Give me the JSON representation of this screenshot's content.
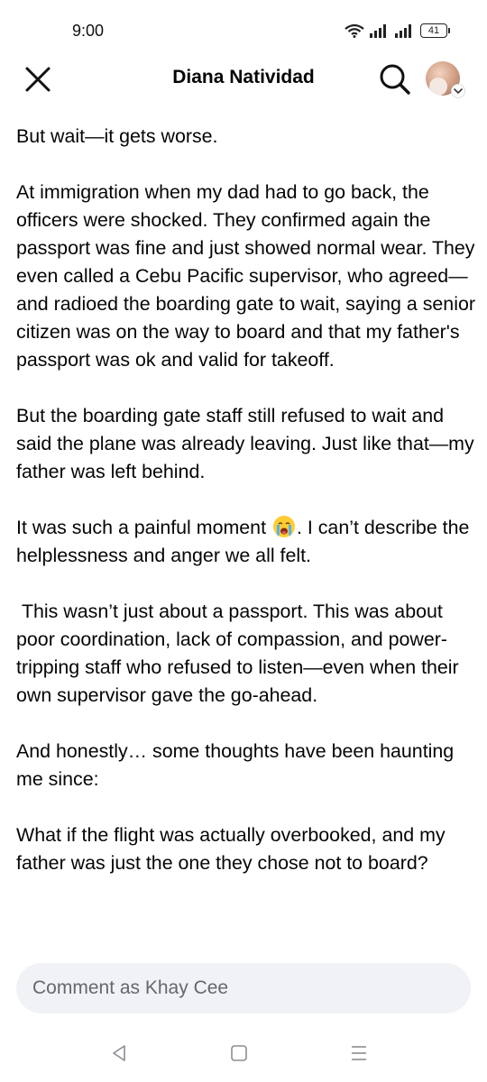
{
  "status": {
    "time": "9:00",
    "battery": "41"
  },
  "header": {
    "title": "Diana Natividad"
  },
  "post": {
    "paragraphs": [
      "But wait—it gets worse.",
      "At immigration when my dad had to go back, the officers were shocked. They confirmed again the passport was fine and just showed normal wear. They even called a Cebu Pacific supervisor, who agreed—and radioed the boarding gate to wait, saying a senior citizen was on the way to board and that my father's passport was ok and valid for takeoff.",
      "But the boarding gate staff still refused to wait and said the plane was already leaving. Just like that—my father was left behind.",
      " This wasn’t just about a passport. This was about poor coordination, lack of compassion, and power-tripping staff who refused to listen—even when their own supervisor gave the go-ahead.",
      "And honestly… some thoughts have been haunting me since:",
      "What if the flight was actually overbooked, and my father was just the one they chose not to board?"
    ],
    "emoji_para": {
      "before": "It was such a painful moment ",
      "emoji_icon": "loudly-crying-face-emoji",
      "after": ". I can’t describe the helplessness and anger we all felt."
    }
  },
  "comment": {
    "placeholder": "Comment as Khay Cee"
  },
  "icons": {
    "close": "close-icon",
    "search": "search-icon",
    "avatar_chevron": "chevron-down-icon",
    "wifi": "wifi-icon",
    "signal": "signal-icon",
    "nav_back": "back-triangle-icon",
    "nav_home": "home-square-icon",
    "nav_menu": "menu-lines-icon"
  }
}
